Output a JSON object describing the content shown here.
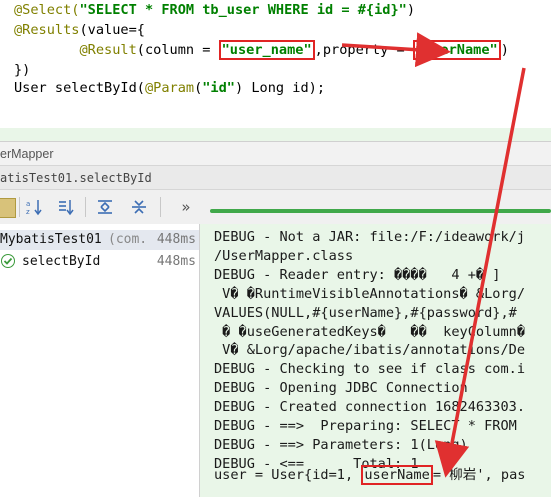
{
  "code": {
    "line1_ann": "@Select(",
    "line1_str": "\"SELECT * FROM tb_user WHERE id = #{id}\"",
    "line1_end": ")",
    "line2_ann": "@Results",
    "line2_rest": "(value={",
    "line3_ann": "@Result",
    "line3_mid": "(column = ",
    "line3_col": "\"user_name\"",
    "line3_mid2": ",property = ",
    "line3_prop": "\"userName\"",
    "line3_end": ")",
    "line4": "})",
    "line5_a": "User selectById(",
    "line5_ann": "@Param",
    "line5_b": "(",
    "line5_str": "\"id\"",
    "line5_c": ") Long id);"
  },
  "run": {
    "title": "erMapper",
    "subtitle": "atisTest01.selectById"
  },
  "toolbar": {
    "more": "»"
  },
  "tree": {
    "root_label": "MybatisTest01",
    "root_pkg": "(com.",
    "root_time": "448ms",
    "child_label": "selectById",
    "child_time": "448ms"
  },
  "console": {
    "lines": [
      "DEBUG - Not a JAR: file:/F:/ideawork/j",
      "/UserMapper.class",
      "DEBUG - Reader entry: ����   4 +� ]",
      " V� �RuntimeVisibleAnnotations� &Lorg/",
      "VALUES(NULL,#{userName},#{password},#",
      " � �useGeneratedKeys�   ��  keyColumn�",
      " V� &Lorg/apache/ibatis/annotations/De",
      "DEBUG - Checking to see if class com.i",
      "DEBUG - Opening JDBC Connection",
      "DEBUG - Created connection 1682463303.",
      "DEBUG - ==>  Preparing: SELECT * FROM",
      "DEBUG - ==> Parameters: 1(Long)",
      "DEBUG - <==      Total: 1"
    ],
    "last_a": "user = User{id=1, ",
    "last_box": "userName",
    "last_b": "='柳岩', pas"
  },
  "colors": {
    "annotation": "#808000",
    "string": "#008000",
    "highlight_box": "#e02424",
    "arrow": "#e03030",
    "console_bg": "#e9f6e8",
    "progress": "#40a84a"
  }
}
